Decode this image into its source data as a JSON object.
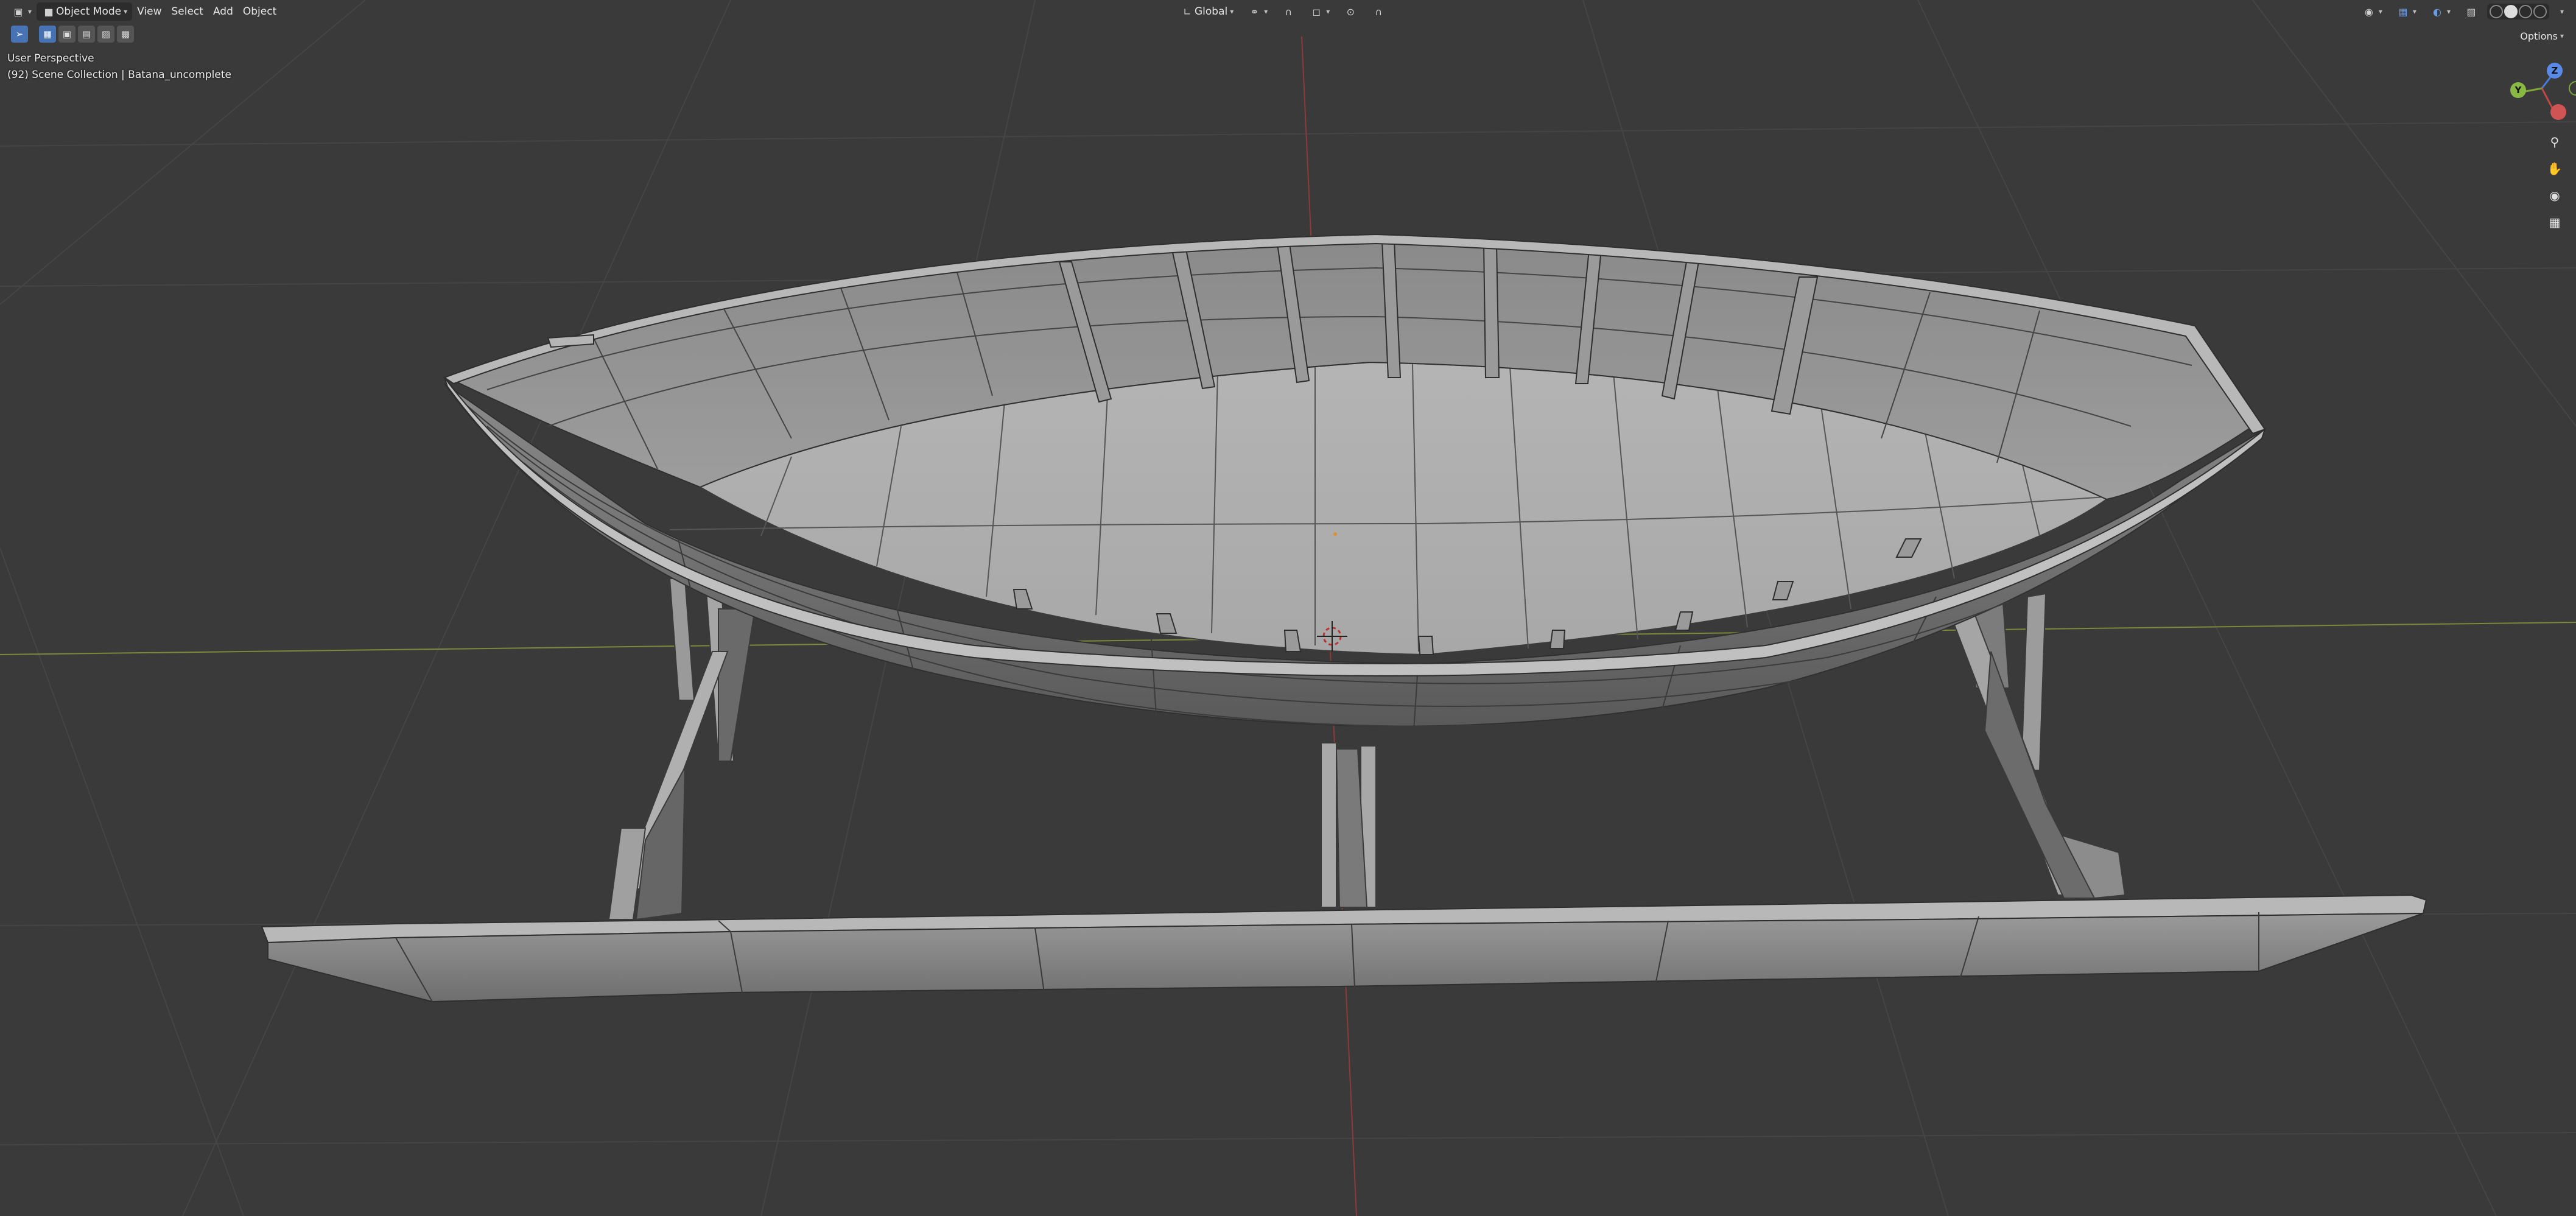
{
  "header": {
    "editor_icon": "viewport-icon",
    "mode_label": "Object Mode",
    "menus": [
      "View",
      "Select",
      "Add",
      "Object"
    ],
    "orientation_label": "Global",
    "options_label": "Options"
  },
  "overlay": {
    "view_name": "User Perspective",
    "collection_info": "(92) Scene Collection | Batana_uncomplete"
  },
  "gizmo": {
    "z": "Z",
    "y": "Y",
    "x": "X"
  },
  "colors": {
    "background": "#3a3a3a",
    "grid": "#4a4a4a",
    "x_axis": "#8c3a3a",
    "y_axis": "#6e8a3a",
    "mesh_light": "#a9a9a9",
    "mesh_dark": "#6b6b6b",
    "active_tool": "#4772b3"
  }
}
